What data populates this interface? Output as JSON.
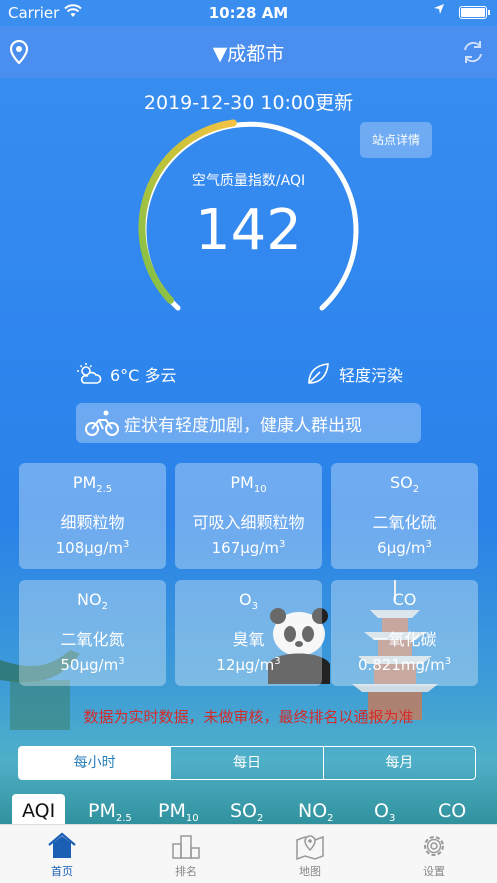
{
  "status_bar": {
    "carrier": "Carrier",
    "time": "10:28 AM"
  },
  "nav": {
    "city": "▼成都市"
  },
  "update_time": "2019-12-30 10:00更新",
  "station_button": "站点详情",
  "aqi": {
    "label": "空气质量指数/AQI",
    "value": "142",
    "fraction_of_max": 0.47
  },
  "weather": {
    "text": "6°C 多云",
    "icon": "partly-cloudy-icon"
  },
  "pollution_level": {
    "text": "轻度污染",
    "icon": "leaf-icon"
  },
  "advice": "症状有轻度加剧，健康人群出现",
  "pollutants": [
    {
      "name": "PM",
      "sub": "2.5",
      "cn": "细颗粒物",
      "value": "108μg/m",
      "sup": "3"
    },
    {
      "name": "PM",
      "sub": "10",
      "cn": "可吸入细颗粒物",
      "value": "167μg/m",
      "sup": "3"
    },
    {
      "name": "SO",
      "sub": "2",
      "cn": "二氧化硫",
      "value": "6μg/m",
      "sup": "3"
    },
    {
      "name": "NO",
      "sub": "2",
      "cn": "二氧化氮",
      "value": "50μg/m",
      "sup": "3"
    },
    {
      "name": "O",
      "sub": "3",
      "cn": "臭氧",
      "value": "12μg/m",
      "sup": "3"
    },
    {
      "name": "CO",
      "sub": "",
      "cn": "一氧化碳",
      "value": "0.821mg/m",
      "sup": "3"
    }
  ],
  "notice": "数据为实时数据，未做审核，最终排名以通报为准",
  "time_segments": [
    "每小时",
    "每日",
    "每月"
  ],
  "pollutant_tabs": [
    {
      "name": "AQI",
      "sub": ""
    },
    {
      "name": "PM",
      "sub": "2.5"
    },
    {
      "name": "PM",
      "sub": "10"
    },
    {
      "name": "SO",
      "sub": "2"
    },
    {
      "name": "NO",
      "sub": "2"
    },
    {
      "name": "O",
      "sub": "3"
    },
    {
      "name": "CO",
      "sub": ""
    }
  ],
  "tabbar": [
    {
      "label": "首页",
      "icon": "home-icon"
    },
    {
      "label": "排名",
      "icon": "podium-icon"
    },
    {
      "label": "地图",
      "icon": "map-icon"
    },
    {
      "label": "设置",
      "icon": "settings-icon"
    }
  ],
  "colors": {
    "accent": "#1a5fb4",
    "notice": "#d42b2b",
    "gauge_start": "#8bc34a",
    "gauge_end": "#f5c243"
  }
}
